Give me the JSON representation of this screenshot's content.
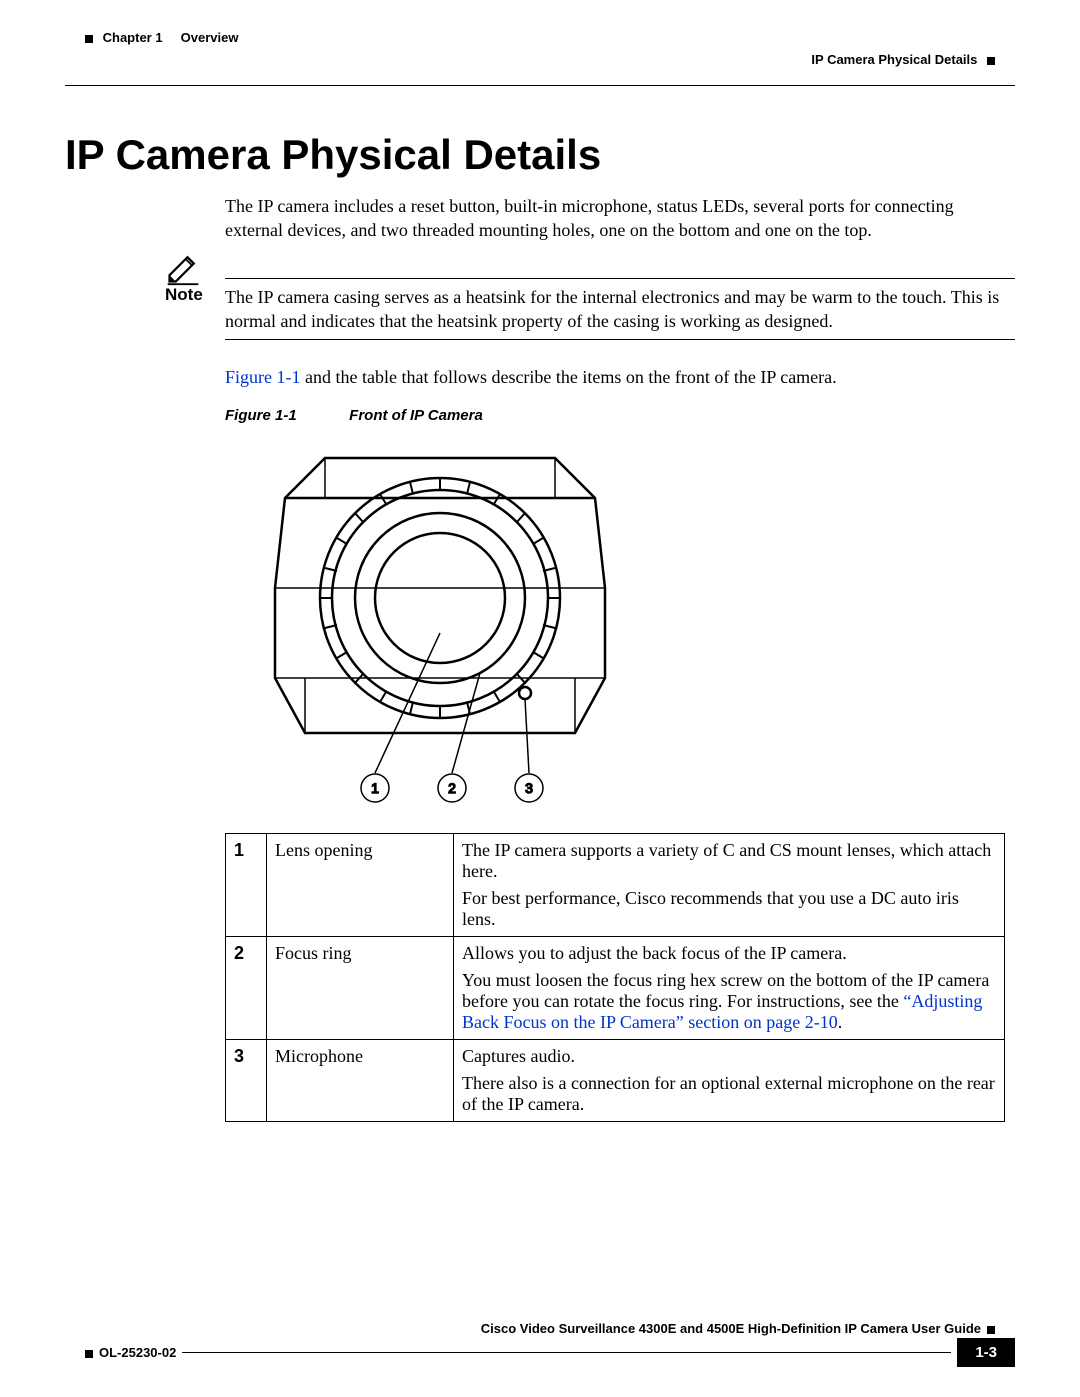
{
  "header": {
    "chapter_label": "Chapter 1",
    "chapter_title": "Overview",
    "section_title": "IP Camera Physical Details"
  },
  "title": "IP Camera Physical Details",
  "intro": "The IP camera includes a reset button, built-in microphone, status LEDs, several ports for connecting external devices, and two threaded mounting holes, one on the bottom and one on the top.",
  "note": {
    "label": "Note",
    "text": "The IP camera casing serves as a heatsink for the internal electronics and may be warm to the touch. This is normal and indicates that the heatsink property of the casing is working as designed."
  },
  "figref_sentence": {
    "link": "Figure 1-1",
    "rest": " and the table that follows describe the items on the front of the IP camera."
  },
  "figure": {
    "label": "Figure 1-1",
    "title": "Front of IP Camera",
    "callouts": [
      "1",
      "2",
      "3"
    ]
  },
  "table": {
    "rows": [
      {
        "num": "1",
        "name": "Lens opening",
        "desc": [
          "The IP camera supports a variety of C and CS mount lenses, which attach here.",
          "For best performance, Cisco recommends that you use a DC auto iris lens."
        ]
      },
      {
        "num": "2",
        "name": "Focus ring",
        "desc_focus": {
          "p1": "Allows you to adjust the back focus of the IP camera.",
          "p2_pre": "You must loosen the focus ring hex screw on the bottom of the IP camera before you can rotate the focus ring. For instructions, see the ",
          "p2_link": "“Adjusting Back Focus on the IP Camera” section on page 2-10",
          "p2_post": "."
        }
      },
      {
        "num": "3",
        "name": "Microphone",
        "desc": [
          "Captures audio.",
          "There also is a connection for an optional external microphone on the rear of the IP camera."
        ]
      }
    ]
  },
  "footer": {
    "book_title": "Cisco Video Surveillance 4300E and 4500E High-Definition IP Camera User Guide",
    "doc_number": "OL-25230-02",
    "page_number": "1-3"
  }
}
